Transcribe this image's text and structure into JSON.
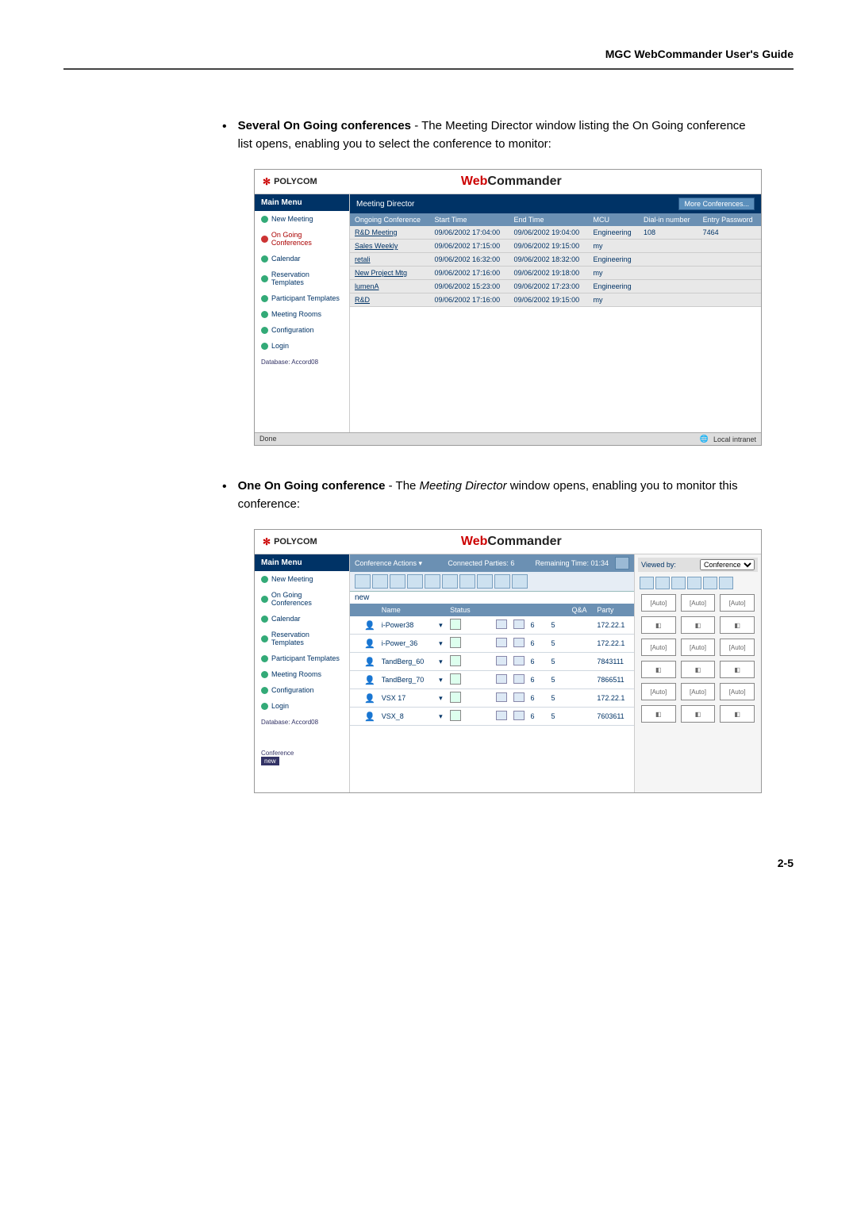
{
  "header": {
    "guide": "MGC WebCommander User's Guide"
  },
  "bullet1": {
    "title": "Several On Going conferences",
    "text": " - The Meeting Director window listing the On Going conference list opens, enabling you to select the conference to monitor:"
  },
  "bullet2": {
    "title": "One On Going conference",
    "text_a": " - The ",
    "text_em": "Meeting Director",
    "text_b": " window opens, enabling you to monitor this conference:"
  },
  "ss": {
    "brand": "POLYCOM",
    "title_web": "Web",
    "title_cmd": "Commander",
    "main_menu": "Main Menu",
    "side": {
      "items": [
        {
          "label": "New Meeting"
        },
        {
          "label": "On Going Conferences"
        },
        {
          "label": "Calendar"
        },
        {
          "label": "Reservation Templates"
        },
        {
          "label": "Participant Templates"
        },
        {
          "label": "Meeting Rooms"
        },
        {
          "label": "Configuration"
        },
        {
          "label": "Login"
        }
      ],
      "db": "Database: Accord08"
    }
  },
  "ss1": {
    "panel_title": "Meeting Director",
    "more": "More Conferences...",
    "headers": [
      "Ongoing Conference",
      "Start Time",
      "End Time",
      "MCU",
      "Dial-in number",
      "Entry Password"
    ],
    "rows": [
      [
        "R&D Meeting",
        "09/06/2002 17:04:00",
        "09/06/2002 19:04:00",
        "Engineering",
        "108",
        "7464"
      ],
      [
        "Sales Weekly",
        "09/06/2002 17:15:00",
        "09/06/2002 19:15:00",
        "my",
        "",
        ""
      ],
      [
        "retali",
        "09/06/2002 16:32:00",
        "09/06/2002 18:32:00",
        "Engineering",
        "",
        ""
      ],
      [
        "New Project Mtg",
        "09/06/2002 17:16:00",
        "09/06/2002 19:18:00",
        "my",
        "",
        ""
      ],
      [
        "lumenA",
        "09/06/2002 15:23:00",
        "09/06/2002 17:23:00",
        "Engineering",
        "",
        ""
      ],
      [
        "R&D",
        "09/06/2002 17:16:00",
        "09/06/2002 19:15:00",
        "my",
        "",
        ""
      ]
    ],
    "status_left": "Done",
    "status_right": "Local intranet"
  },
  "ss2": {
    "tb": {
      "actions": "Conference Actions ▾",
      "connected": "Connected Parties: 6",
      "remaining": "Remaining Time: 01:34",
      "viewed": "Viewed by:",
      "viewed_val": "Conference"
    },
    "label_new": "new",
    "headers": [
      "",
      "",
      "Name",
      "",
      "Status",
      "",
      "",
      "",
      "",
      "",
      "Q&A",
      "Party"
    ],
    "rows": [
      {
        "name": "i-Power38",
        "a": "6",
        "b": "5",
        "party": "172.22.1"
      },
      {
        "name": "i-Power_36",
        "a": "6",
        "b": "5",
        "party": "172.22.1"
      },
      {
        "name": "TandBerg_60",
        "a": "6",
        "b": "5",
        "party": "7843111"
      },
      {
        "name": "TandBerg_70",
        "a": "6",
        "b": "5",
        "party": "7866511"
      },
      {
        "name": "VSX 17",
        "a": "6",
        "b": "5",
        "party": "172.22.1"
      },
      {
        "name": "VSX_8",
        "a": "6",
        "b": "5",
        "party": "7603611"
      }
    ],
    "conf_label": "Conference",
    "conf_val": "new",
    "auto": "[Auto]"
  },
  "page": "2-5"
}
